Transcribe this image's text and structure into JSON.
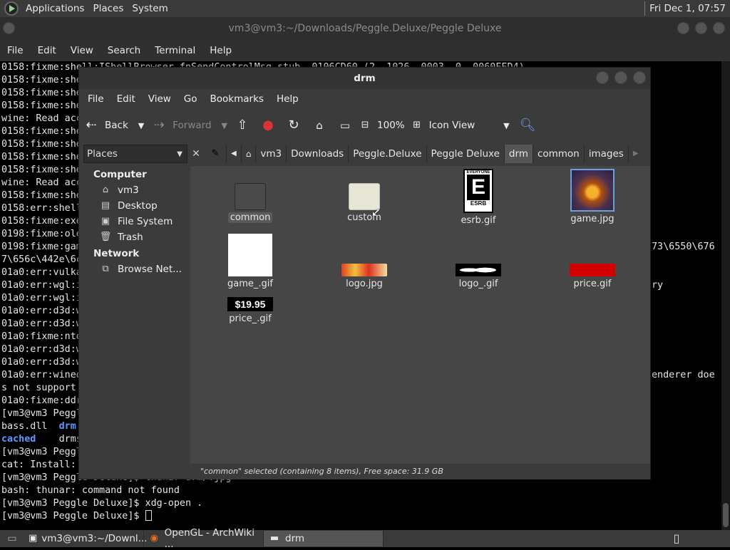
{
  "top_panel": {
    "menus": [
      "Applications",
      "Places",
      "System"
    ],
    "clock": "Fri Dec  1, 07:57"
  },
  "terminal": {
    "title": "vm3@vm3:~/Downloads/Peggle.Deluxe/Peggle Deluxe",
    "menus": [
      "File",
      "Edit",
      "View",
      "Search",
      "Terminal",
      "Help"
    ],
    "lines": [
      "0158:fixme:shell:IShellBrowser_fnSendControlMsg stub, 0106CD60 (2, 1026, 0003, 0, 0060EED4)",
      "0158:fixme:she",
      "0158:fixme:she",
      "0158:fixme:she",
      "wine: Read acc",
      "0158:fixme:she",
      "0158:fixme:she",
      "0158:fixme:she",
      "0158:fixme:she",
      "wine: Read acc",
      "0158:fixme:she",
      "0158:err:shell",
      "0158:fixme:exe",
      "0198:fixme:ole",
      "0198:fixme:gam",
      "7\\656c\\442e\\6c",
      "01a0:err:vulka",
      "01a0:err:wgl:i",
      "01a0:err:wgl:i",
      "01a0:err:d3d:w",
      "01a0:err:d3d:w",
      "01a0:fixme:ntd",
      "01a0:err:d3d:w",
      "01a0:err:d3d:w",
      "01a0:err:wined",
      "s not support ",
      "01a0:fixme:ddr",
      "[vm3@vm3 Peggl",
      "bass.dll  drm ",
      "cached    drms",
      "[vm3@vm3 Peggl",
      "cat: Install: ",
      "[vm3@vm3 Peggle Deluxe]$ thunar drm/.jpg",
      "bash: thunar: command not found",
      "[vm3@vm3 Peggle Deluxe]$ xdg-open .",
      "[vm3@vm3 Peggle Deluxe]$ "
    ],
    "right_fragments": [
      {
        "line": 14,
        "text": "73\\6550\\676"
      },
      {
        "line": 17,
        "text": "ry"
      },
      {
        "line": 24,
        "text": "enderer doe"
      }
    ]
  },
  "file_manager": {
    "title": "drm",
    "menus": [
      "File",
      "Edit",
      "View",
      "Go",
      "Bookmarks",
      "Help"
    ],
    "toolbar": {
      "back": "Back",
      "forward": "Forward",
      "zoom": "100%",
      "view_mode": "Icon View"
    },
    "places_label": "Places",
    "breadcrumbs": [
      "vm3",
      "Downloads",
      "Peggle.Deluxe",
      "Peggle Deluxe",
      "drm",
      "common",
      "images"
    ],
    "active_crumb": "drm",
    "sidebar": {
      "computer_header": "Computer",
      "computer_items": [
        {
          "label": "vm3",
          "icon": "home-folder-icon"
        },
        {
          "label": "Desktop",
          "icon": "desktop-folder-icon"
        },
        {
          "label": "File System",
          "icon": "filesystem-icon"
        },
        {
          "label": "Trash",
          "icon": "trash-icon"
        }
      ],
      "network_header": "Network",
      "network_items": [
        {
          "label": "Browse Net...",
          "icon": "network-icon"
        }
      ]
    },
    "files": [
      {
        "name": "common",
        "kind": "folder-dark",
        "selected": true
      },
      {
        "name": "custom",
        "kind": "folder-light",
        "selected": false
      },
      {
        "name": "esrb.gif",
        "kind": "esrb",
        "rating": "E",
        "top_text": "EVERYONE",
        "bottom_text": "ESRB",
        "selected": false
      },
      {
        "name": "game.jpg",
        "kind": "game-thumb",
        "selected": false
      },
      {
        "name": "game_.gif",
        "kind": "white-thumb",
        "selected": false
      },
      {
        "name": "logo.jpg",
        "kind": "logo-thumb",
        "selected": false
      },
      {
        "name": "logo_.gif",
        "kind": "logo-mask-thumb",
        "selected": false
      },
      {
        "name": "price.gif",
        "kind": "red-thumb",
        "selected": false
      },
      {
        "name": "price_.gif",
        "kind": "price-thumb",
        "price": "$19.95",
        "selected": false
      }
    ],
    "status": "\"common\" selected (containing 8 items), Free space: 31.9 GB"
  },
  "taskbar": {
    "tasks": [
      {
        "label": "vm3@vm3:~/Downl...",
        "icon": "terminal-icon",
        "active": false
      },
      {
        "label": "OpenGL - ArchWiki ...",
        "icon": "firefox-icon",
        "active": false
      },
      {
        "label": "drm",
        "icon": "folder-icon",
        "active": true
      }
    ]
  },
  "colors": {
    "panel": "#3a3a3a",
    "terminal_bg": "#000000",
    "dir_blue": "#5c9cff",
    "fm_view": "#464646"
  }
}
